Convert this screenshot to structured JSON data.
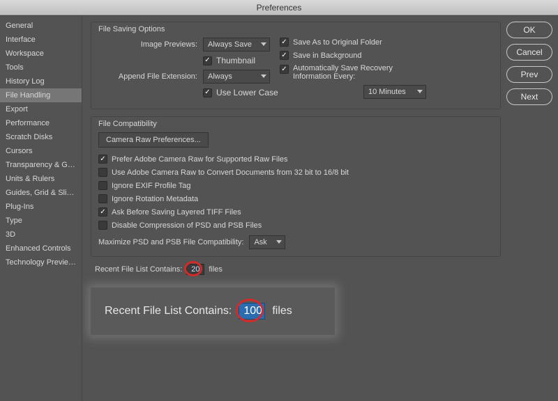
{
  "title": "Preferences",
  "buttons": {
    "ok": "OK",
    "cancel": "Cancel",
    "prev": "Prev",
    "next": "Next"
  },
  "sidebar": {
    "items": [
      "General",
      "Interface",
      "Workspace",
      "Tools",
      "History Log",
      "File Handling",
      "Export",
      "Performance",
      "Scratch Disks",
      "Cursors",
      "Transparency & Gamut",
      "Units & Rulers",
      "Guides, Grid & Slices",
      "Plug-Ins",
      "Type",
      "3D",
      "Enhanced Controls",
      "Technology Previews"
    ],
    "active_index": 5
  },
  "file_saving": {
    "title": "File Saving Options",
    "image_previews_label": "Image Previews:",
    "image_previews_value": "Always Save",
    "thumbnail": "Thumbnail",
    "append_ext_label": "Append File Extension:",
    "append_ext_value": "Always",
    "use_lower_case": "Use Lower Case",
    "save_as_original": "Save As to Original Folder",
    "save_in_background": "Save in Background",
    "auto_save_label": "Automatically Save Recovery Information Every:",
    "auto_save_interval": "10 Minutes"
  },
  "file_compat": {
    "title": "File Compatibility",
    "camera_raw_btn": "Camera Raw Preferences...",
    "prefer_acr": "Prefer Adobe Camera Raw for Supported Raw Files",
    "use_acr_convert": "Use Adobe Camera Raw to Convert Documents from 32 bit to 16/8 bit",
    "ignore_exif": "Ignore EXIF Profile Tag",
    "ignore_rotation": "Ignore Rotation Metadata",
    "ask_layered_tiff": "Ask Before Saving Layered TIFF Files",
    "disable_compression": "Disable Compression of PSD and PSB Files",
    "maximize_label": "Maximize PSD and PSB File Compatibility:",
    "maximize_value": "Ask"
  },
  "recent": {
    "label": "Recent File List Contains:",
    "value": "20",
    "suffix": "files"
  },
  "zoom": {
    "label": "Recent File List Contains:",
    "value": "100",
    "suffix": "files"
  }
}
